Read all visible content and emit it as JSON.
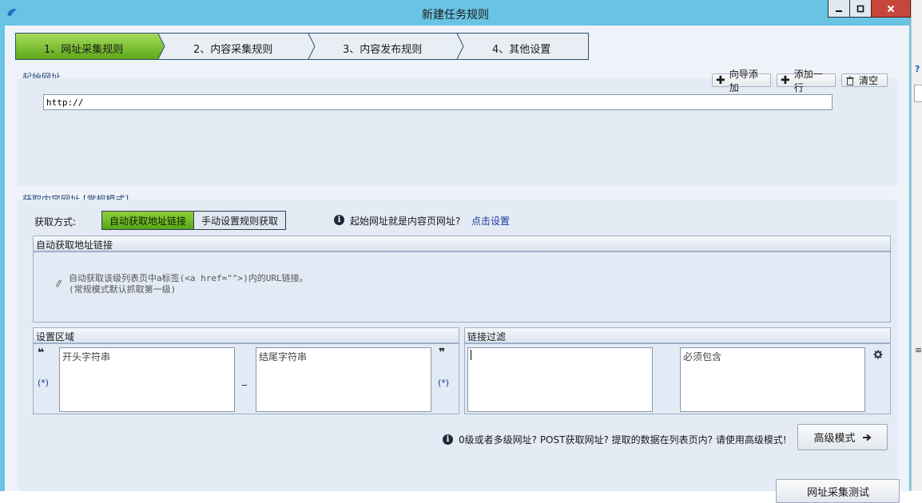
{
  "window": {
    "title": "新建任务规则"
  },
  "wizard": {
    "steps": [
      {
        "label": "1、网址采集规则",
        "active": true
      },
      {
        "label": "2、内容采集规则",
        "active": false
      },
      {
        "label": "3、内容发布规则",
        "active": false
      },
      {
        "label": "4、其他设置",
        "active": false
      }
    ]
  },
  "start_url": {
    "section_title": "起始网址",
    "wizard_add_label": "向导添加",
    "add_row_label": "添加一行",
    "clear_label": "清空",
    "url_value": "http://"
  },
  "content_url": {
    "section_title": "获取内容网址 [常规模式]",
    "method_label": "获取方式:",
    "auto_label": "自动获取地址链接",
    "manual_label": "手动设置规则获取",
    "hint_text": "起始网址就是内容页网址?",
    "hint_link": "点击设置",
    "auto_box_title": "自动获取地址链接",
    "auto_desc_line1": "自动获取该级列表页中a标签(<a href=\"\">)内的URL链接。",
    "auto_desc_line2": "(常规模式默认抓取第一级)"
  },
  "area": {
    "title": "设置区域",
    "start_placeholder": "开头字符串",
    "end_placeholder": "结尾字符串",
    "open_quote": "❝",
    "close_quote": "❞",
    "wildcard": "(*)",
    "dash": "_"
  },
  "filter": {
    "title": "链接过滤",
    "must_contain_placeholder": "必须包含"
  },
  "footer": {
    "advanced_hint": "0级或者多级网址? POST获取网址? 提取的数据在列表页内? 请使用高级模式!",
    "advanced_button": "高级模式",
    "test_button": "网址采集测试"
  },
  "background_app": {
    "help_glyph": "?",
    "menu_glyph": "≡"
  },
  "colors": {
    "titlebar": "#69c3e3",
    "active_step": "#7cc12a",
    "close_button": "#c7473c",
    "link": "#1b3a9a"
  }
}
